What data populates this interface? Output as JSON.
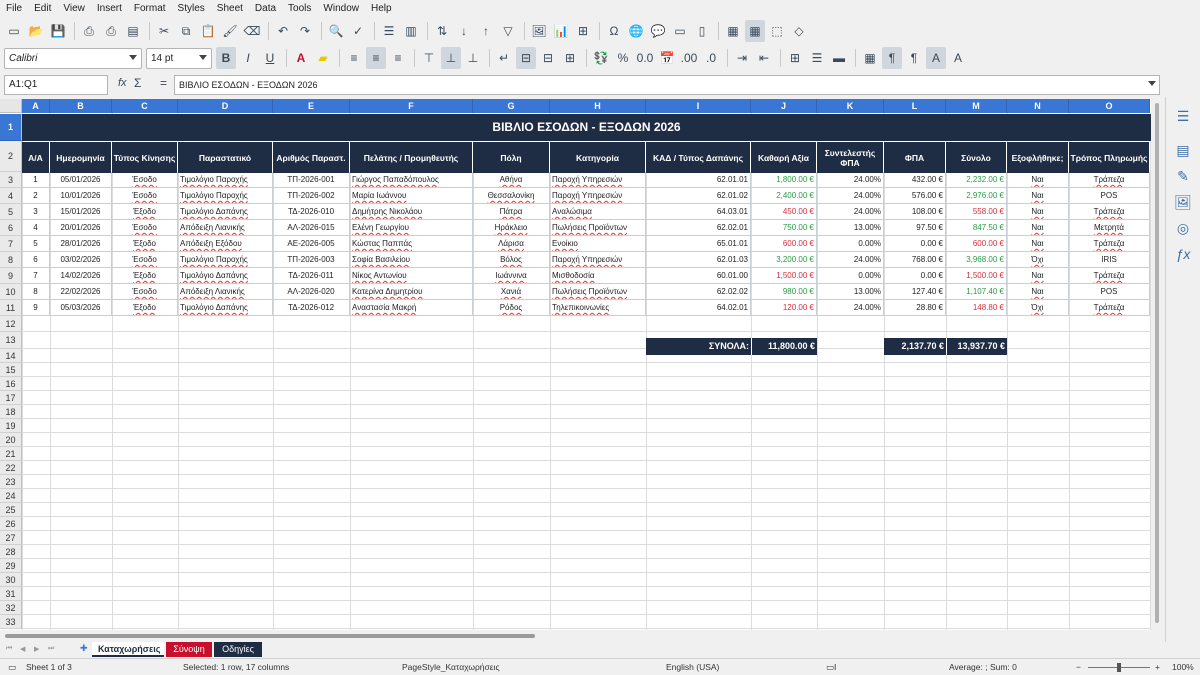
{
  "menu": [
    "File",
    "Edit",
    "View",
    "Insert",
    "Format",
    "Styles",
    "Sheet",
    "Data",
    "Tools",
    "Window",
    "Help"
  ],
  "toolbar2": {
    "font_name": "Calibri",
    "font_size": "14 pt",
    "bold": "B",
    "italic": "I",
    "underline": "U"
  },
  "formula_bar": {
    "name_box": "A1:Q1",
    "fx": "fx",
    "sum": "Σ",
    "eq": "=",
    "content": "ΒΙΒΛΙΟ ΕΣΟΔΩΝ - ΕΞΟΔΩΝ 2026"
  },
  "columns": [
    "A",
    "B",
    "C",
    "D",
    "E",
    "F",
    "G",
    "H",
    "I",
    "J",
    "K",
    "L",
    "M",
    "N",
    "O"
  ],
  "row_numbers": [
    "1",
    "2",
    "3",
    "4",
    "5",
    "6",
    "7",
    "8",
    "9",
    "10",
    "11",
    "12",
    "13",
    "14",
    "15",
    "16",
    "17",
    "18",
    "19",
    "20",
    "21",
    "22",
    "23",
    "24",
    "25",
    "26",
    "27",
    "28",
    "29",
    "30",
    "31",
    "32",
    "33"
  ],
  "title": "ΒΙΒΛΙΟ ΕΣΟΔΩΝ - ΕΞΟΔΩΝ 2026",
  "headers": [
    "Α/Α",
    "Ημερομηνία",
    "Τύπος Κίνησης",
    "Παραστατικό",
    "Αριθμός Παραστ.",
    "Πελάτης / Προμηθευτής",
    "Πόλη",
    "Κατηγορία",
    "ΚΑΔ / Τύπος Δαπάνης",
    "Καθαρή Αξία",
    "Συντελεστής ΦΠΑ",
    "ΦΠΑ",
    "Σύνολο",
    "Εξοφλήθηκε;",
    "Τρόπος Πληρωμής"
  ],
  "rows": [
    [
      "1",
      "05/01/2026",
      "Έσοδο",
      "Τιμολόγιο Παροχής",
      "ΤΠ-2026-001",
      "Γιώργος Παπαδόπουλος",
      "Αθήνα",
      "Παροχή Υπηρεσιών",
      "62.01.01",
      "1,800.00 €",
      "24.00%",
      "432.00 €",
      "2,232.00 €",
      "Ναι",
      "Τράπεζα"
    ],
    [
      "2",
      "10/01/2026",
      "Έσοδο",
      "Τιμολόγιο Παροχής",
      "ΤΠ-2026-002",
      "Μαρία Ιωάννου",
      "Θεσσαλονίκη",
      "Παροχή Υπηρεσιών",
      "62.01.02",
      "2,400.00 €",
      "24.00%",
      "576.00 €",
      "2,976.00 €",
      "Ναι",
      "POS"
    ],
    [
      "3",
      "15/01/2026",
      "Έξοδο",
      "Τιμολόγιο Δαπάνης",
      "ΤΔ-2026-010",
      "Δημήτρης Νικολάου",
      "Πάτρα",
      "Αναλώσιμα",
      "64.03.01",
      "450.00 €",
      "24.00%",
      "108.00 €",
      "558.00 €",
      "Ναι",
      "Τράπεζα"
    ],
    [
      "4",
      "20/01/2026",
      "Έσοδο",
      "Απόδειξη Λιανικής",
      "ΑΛ-2026-015",
      "Ελένη Γεωργίου",
      "Ηράκλειο",
      "Πωλήσεις Προϊόντων",
      "62.02.01",
      "750.00 €",
      "13.00%",
      "97.50 €",
      "847.50 €",
      "Ναι",
      "Μετρητά"
    ],
    [
      "5",
      "28/01/2026",
      "Έξοδο",
      "Απόδειξη Εξόδου",
      "ΑΕ-2026-005",
      "Κώστας Παππάς",
      "Λάρισα",
      "Ενοίκιο",
      "65.01.01",
      "600.00 €",
      "0.00%",
      "0.00 €",
      "600.00 €",
      "Ναι",
      "Τράπεζα"
    ],
    [
      "6",
      "03/02/2026",
      "Έσοδο",
      "Τιμολόγιο Παροχής",
      "ΤΠ-2026-003",
      "Σοφία Βασιλείου",
      "Βόλος",
      "Παροχή Υπηρεσιών",
      "62.01.03",
      "3,200.00 €",
      "24.00%",
      "768.00 €",
      "3,968.00 €",
      "Όχι",
      "IRIS"
    ],
    [
      "7",
      "14/02/2026",
      "Έξοδο",
      "Τιμολόγιο Δαπάνης",
      "ΤΔ-2026-011",
      "Νίκος Αντωνίου",
      "Ιωάννινα",
      "Μισθοδοσία",
      "60.01.00",
      "1,500.00 €",
      "0.00%",
      "0.00 €",
      "1,500.00 €",
      "Ναι",
      "Τράπεζα"
    ],
    [
      "8",
      "22/02/2026",
      "Έσοδο",
      "Απόδειξη Λιανικής",
      "ΑΛ-2026-020",
      "Κατερίνα Δημητρίου",
      "Χανιά",
      "Πωλήσεις Προϊόντων",
      "62.02.02",
      "980.00 €",
      "13.00%",
      "127.40 €",
      "1,107.40 €",
      "Ναι",
      "POS"
    ],
    [
      "9",
      "05/03/2026",
      "Έξοδο",
      "Τιμολόγιο Δαπάνης",
      "ΤΔ-2026-012",
      "Αναστασία Μακρή",
      "Ρόδος",
      "Τηλεπικοινωνίες",
      "64.02.01",
      "120.00 €",
      "24.00%",
      "28.80 €",
      "148.80 €",
      "Όχι",
      "Τράπεζα"
    ]
  ],
  "totals": {
    "label": "ΣΥΝΟΛΑ:",
    "net": "11,800.00 €",
    "vat": "2,137.70 €",
    "total": "13,937.70 €"
  },
  "tabs": [
    "Καταχωρήσεις",
    "Σύνοψη",
    "Οδηγίες"
  ],
  "status": {
    "sheet": "Sheet 1 of 3",
    "selection": "Selected: 1 row, 17 columns",
    "page_style": "PageStyle_Καταχωρήσεις",
    "language": "English (USA)",
    "stats": "Average: ; Sum: 0",
    "zoom": "100%"
  },
  "colors": {
    "header_bg": "#1f2d44",
    "accent_blue": "#3a76d4",
    "income_green": "#2a9d44",
    "expense_red": "#d4313b",
    "tab2_bg": "#c8102e"
  }
}
